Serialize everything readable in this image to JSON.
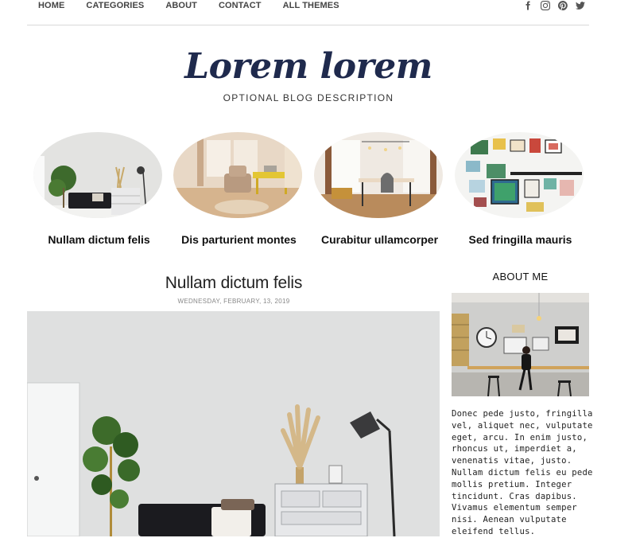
{
  "nav": {
    "links": [
      "HOME",
      "CATEGORIES",
      "ABOUT",
      "CONTACT",
      "ALL THEMES"
    ],
    "social_icons": [
      "facebook-icon",
      "instagram-icon",
      "pinterest-icon",
      "twitter-icon"
    ]
  },
  "header": {
    "title": "Lorem lorem",
    "description": "OPTIONAL BLOG DESCRIPTION"
  },
  "featured": [
    {
      "title": "Nullam dictum felis"
    },
    {
      "title": "Dis parturient montes"
    },
    {
      "title": "Curabitur ullamcorper"
    },
    {
      "title": "Sed fringilla mauris"
    }
  ],
  "post": {
    "title": "Nullam dictum felis",
    "date": "WEDNESDAY, FEBRUARY, 13, 2019"
  },
  "sidebar": {
    "about_heading": "ABOUT ME",
    "about_text": "Donec pede justo, fringilla vel, aliquet nec, vulputate eget, arcu. In enim justo, rhoncus ut, imperdiet a, venenatis vitae, justo. Nullam dictum felis eu pede mollis pretium. Integer tincidunt. Cras dapibus. Vivamus elementum semper nisi. Aenean vulputate eleifend tellus."
  },
  "colors": {
    "title_navy": "#1f2a4d",
    "nav_text": "#444444",
    "divider": "#d9d9d9"
  }
}
